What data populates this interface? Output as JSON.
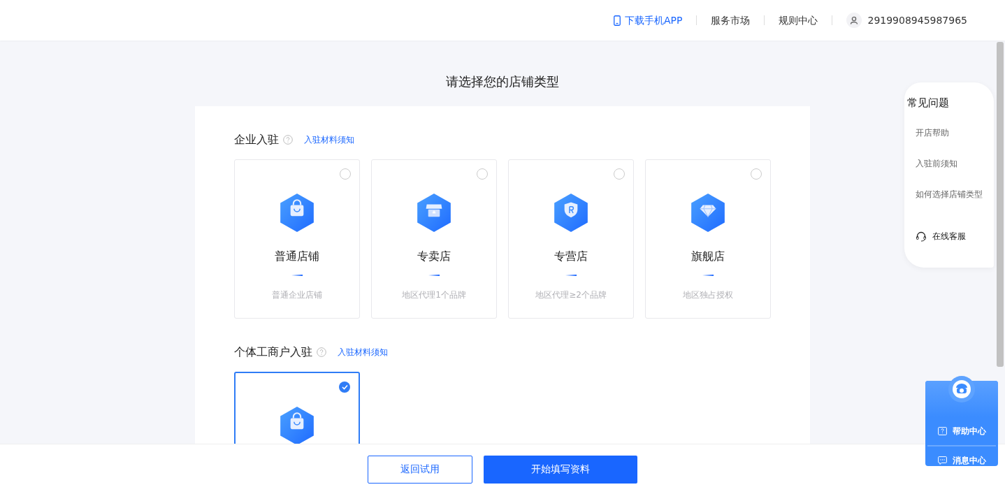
{
  "header": {
    "app_link": "下载手机APP",
    "links": [
      "服务市场",
      "规则中心"
    ],
    "account": "2919908945987965"
  },
  "title": "请选择您的店铺类型",
  "sections": [
    {
      "title": "企业入驻",
      "link": "入驻材料须知",
      "cards": [
        {
          "kind": "bag",
          "name": "普通店铺",
          "desc": "普通企业店铺",
          "selected": false
        },
        {
          "kind": "store",
          "name": "专卖店",
          "desc": "地区代理1个品牌",
          "selected": false
        },
        {
          "kind": "shield",
          "name": "专营店",
          "desc": "地区代理≥2个品牌",
          "selected": false
        },
        {
          "kind": "diamond",
          "name": "旗舰店",
          "desc": "地区独占授权",
          "selected": false
        }
      ]
    },
    {
      "title": "个体工商户入驻",
      "link": "入驻材料须知",
      "cards": [
        {
          "kind": "bag",
          "selected": true
        }
      ]
    }
  ],
  "faq": {
    "title": "常见问题",
    "items": [
      "开店帮助",
      "入驻前须知",
      "如何选择店铺类型"
    ],
    "service": "在线客服"
  },
  "help_widget": {
    "items": [
      {
        "kind": "help",
        "label": "帮助中心"
      },
      {
        "kind": "message",
        "label": "消息中心"
      }
    ]
  },
  "footer": {
    "buttons": [
      {
        "kind": "outline",
        "label": "返回试用"
      },
      {
        "kind": "primary",
        "label": "开始填写资料"
      }
    ]
  }
}
